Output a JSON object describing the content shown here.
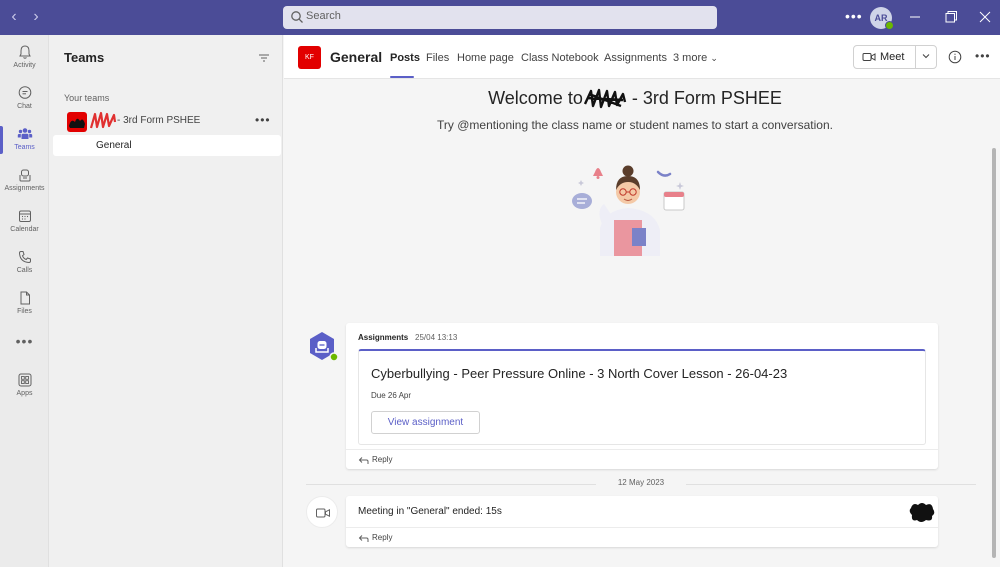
{
  "titlebar": {
    "search_placeholder": "Search",
    "avatar_initials": "AR"
  },
  "rail": {
    "items": [
      {
        "label": "Activity",
        "icon": "bell-icon"
      },
      {
        "label": "Chat",
        "icon": "chat-icon"
      },
      {
        "label": "Teams",
        "icon": "teams-icon"
      },
      {
        "label": "Assignments",
        "icon": "assignments-icon"
      },
      {
        "label": "Calendar",
        "icon": "calendar-icon"
      },
      {
        "label": "Calls",
        "icon": "phone-icon"
      },
      {
        "label": "Files",
        "icon": "file-icon"
      },
      {
        "label": "Apps",
        "icon": "apps-icon"
      }
    ],
    "more": "•••",
    "active": "Teams"
  },
  "teams_pane": {
    "title": "Teams",
    "section": "Your teams",
    "team_name": "- 3rd Form PSHEE",
    "team_more": "•••",
    "channel": "General"
  },
  "channel_header": {
    "badge": "KF",
    "title": "General",
    "tabs": [
      "Posts",
      "Files",
      "Home page",
      "Class Notebook",
      "Assignments",
      "3 more"
    ],
    "active_tab": "Posts",
    "meet_label": "Meet",
    "more": "•••"
  },
  "posts": {
    "welcome_prefix": "Welcome to",
    "welcome_suffix": " - 3rd Form PSHEE",
    "welcome_sub": "Try @mentioning the class name or student names to start a conversation.",
    "assignment_post": {
      "author": "Assignments",
      "time": "25/04 13:13",
      "title": "Cyberbullying - Peer Pressure Online - 3 North Cover Lesson - 26-04-23",
      "due": "Due 26 Apr",
      "button": "View assignment",
      "reply": "Reply"
    },
    "date_separator": "12 May 2023",
    "meeting_post": {
      "text": "Meeting in \"General\" ended: 15s",
      "reply": "Reply"
    }
  },
  "colors": {
    "titlebar": "#4b4c97",
    "accent": "#5b5fc7",
    "team_badge": "#e20000",
    "presence": "#6bb700"
  }
}
